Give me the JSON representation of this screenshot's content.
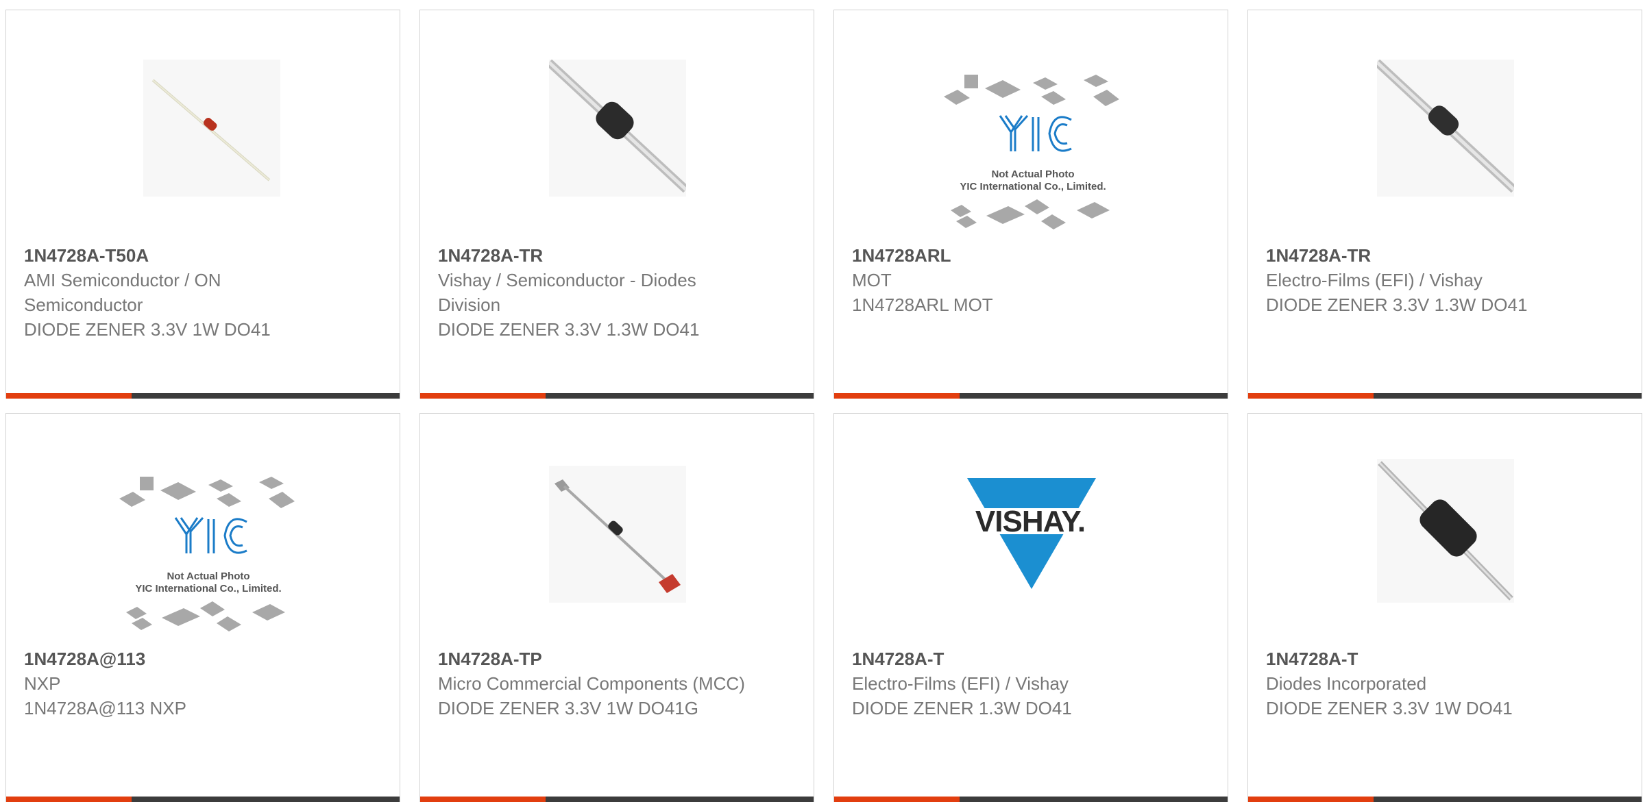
{
  "cards": [
    {
      "part": "1N4728A-T50A",
      "manufacturer": "AMI Semiconductor / ON Semiconductor",
      "description": "DIODE ZENER 3.3V 1W DO41",
      "image": "axial-diode-red-icon"
    },
    {
      "part": "1N4728A-TR",
      "manufacturer": "Vishay / Semiconductor - Diodes Division",
      "description": "DIODE ZENER 3.3V 1.3W DO41",
      "image": "axial-diode-black-icon"
    },
    {
      "part": "1N4728ARL",
      "manufacturer": "MOT",
      "description": "1N4728ARL MOT",
      "image": "yic-placeholder-icon",
      "photo_text_1": "Not Actual Photo",
      "photo_text_2": "YIC International Co., Limited."
    },
    {
      "part": "1N4728A-TR",
      "manufacturer": "Electro-Films (EFI) / Vishay",
      "description": "DIODE ZENER 3.3V 1.3W DO41",
      "image": "axial-diode-black-icon"
    },
    {
      "part": "1N4728A@113",
      "manufacturer": "NXP",
      "description": "1N4728A@113 NXP",
      "image": "yic-placeholder-icon",
      "photo_text_1": "Not Actual Photo",
      "photo_text_2": "YIC International Co., Limited."
    },
    {
      "part": "1N4728A-TP",
      "manufacturer": "Micro Commercial Components (MCC)",
      "description": "DIODE ZENER 3.3V 1W DO41G",
      "image": "taped-diode-icon"
    },
    {
      "part": "1N4728A-T",
      "manufacturer": "Electro-Films (EFI) / Vishay",
      "description": "DIODE ZENER 1.3W DO41",
      "image": "vishay-logo",
      "logo_text": "VISHAY."
    },
    {
      "part": "1N4728A-T",
      "manufacturer": "Diodes Incorporated",
      "description": "DIODE ZENER 3.3V 1W DO41",
      "image": "axial-diode-large-black-icon"
    }
  ],
  "colors": {
    "accent": "#e23e0f",
    "bar": "#3c3c3c",
    "text": "#777777",
    "vishay_blue": "#1b8fd1"
  }
}
